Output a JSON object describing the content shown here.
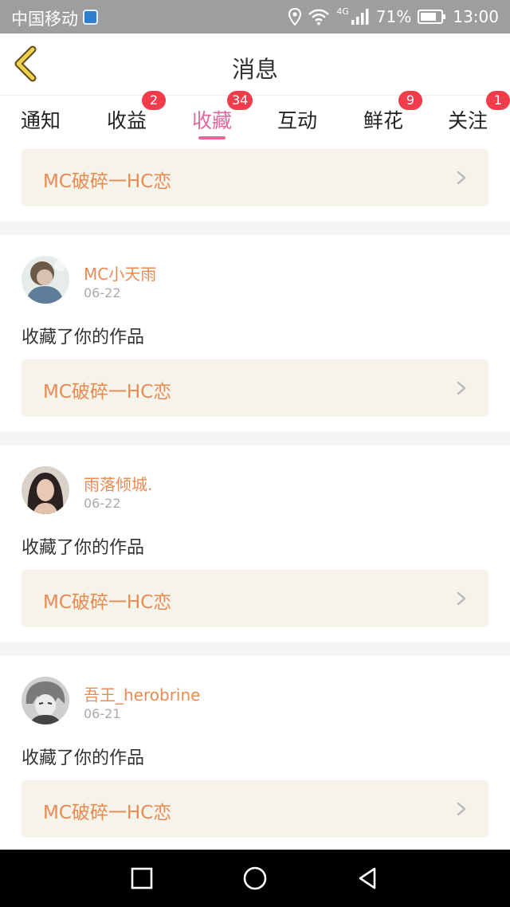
{
  "status_bar": {
    "carrier": "中国移动",
    "network": "4G",
    "battery": "71%",
    "time": "13:00"
  },
  "header": {
    "title": "消息"
  },
  "tabs": [
    {
      "label": "通知",
      "badge": ""
    },
    {
      "label": "收益",
      "badge": "2"
    },
    {
      "label": "收藏",
      "badge": "34",
      "active": true
    },
    {
      "label": "互动",
      "badge": ""
    },
    {
      "label": "鲜花",
      "badge": "9"
    },
    {
      "label": "关注",
      "badge": "1"
    }
  ],
  "top_card": {
    "work_title": "MC破碎一HC恋"
  },
  "messages": [
    {
      "user": "MC小天雨",
      "date": "06-22",
      "text": "收藏了你的作品",
      "work_title": "MC破碎一HC恋"
    },
    {
      "user": "雨落倾城.",
      "date": "06-22",
      "text": "收藏了你的作品",
      "work_title": "MC破碎一HC恋"
    },
    {
      "user": "吾王_herobrine",
      "date": "06-21",
      "text": "收藏了你的作品",
      "work_title": "MC破碎一HC恋"
    }
  ],
  "colors": {
    "accent_pink": "#e4679b",
    "link_orange": "#e98a53",
    "badge_red": "#f03c4b",
    "card_bg": "#f5f3ea"
  }
}
